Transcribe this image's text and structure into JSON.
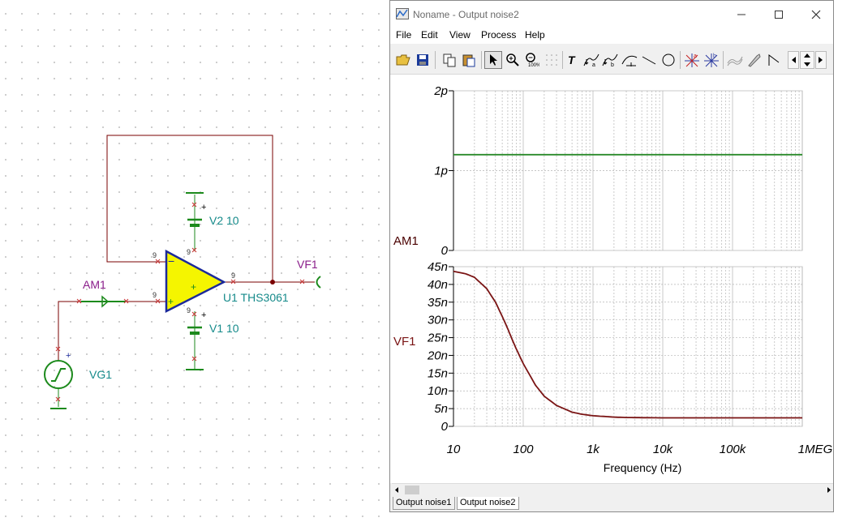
{
  "schematic": {
    "labels": {
      "v2": "V2 10",
      "v1": "V1 10",
      "u1": "U1 THS3061",
      "vf1": "VF1",
      "am1": "AM1",
      "vg1": "VG1"
    },
    "pin_numbers": [
      "9",
      "9",
      "9",
      "9",
      "9"
    ],
    "colors": {
      "opamp_fill": "#f5f500",
      "component": "#1c8a1c",
      "wire": "#7a0000",
      "label": "#158a8a",
      "meter_label": "#8a1d8a"
    }
  },
  "window": {
    "title": "Noname - Output noise2",
    "controls": [
      "minimize",
      "maximize",
      "close"
    ],
    "menu": [
      "File",
      "Edit",
      "View",
      "Process",
      "Help"
    ],
    "toolbar_icons": [
      "open-icon",
      "save-icon",
      "copy-icon",
      "paste-icon",
      "pointer-icon",
      "zoom-in-icon",
      "zoom-100-icon",
      "grid-icon",
      "text-icon",
      "cursor-a-icon",
      "cursor-b-icon",
      "curve-icon",
      "line-icon",
      "circle-icon",
      "marker-a-icon",
      "marker-b-icon",
      "wave-icon",
      "probe-icon",
      "flag-icon",
      "scroll-left-icon",
      "scroll-up-down-icon",
      "scroll-right-icon"
    ],
    "tabs": [
      {
        "label": "Output noise1",
        "active": false
      },
      {
        "label": "Output noise2",
        "active": true
      }
    ]
  },
  "chart_data": [
    {
      "type": "line",
      "ylabel": "AM1",
      "y_ticks": [
        "2p",
        "1p",
        "0"
      ],
      "ylim": [
        0,
        2e-12
      ],
      "xscale": "log",
      "xlim": [
        10,
        1000000
      ],
      "grid": true,
      "series": [
        {
          "color": "#2a8a2a",
          "x": [
            10,
            1000000
          ],
          "y": [
            1.2e-12,
            1.2e-12
          ]
        }
      ]
    },
    {
      "type": "line",
      "ylabel": "VF1",
      "xlabel": "Frequency (Hz)",
      "x_ticks": [
        "10",
        "100",
        "1k",
        "10k",
        "100k",
        "1MEG"
      ],
      "y_ticks": [
        "45n",
        "40n",
        "35n",
        "30n",
        "25n",
        "20n",
        "15n",
        "10n",
        "5n",
        "0"
      ],
      "ylim": [
        0,
        4.5e-08
      ],
      "xscale": "log",
      "xlim": [
        10,
        1000000
      ],
      "grid": true,
      "series": [
        {
          "color": "#7a1414",
          "x": [
            10,
            15,
            20,
            30,
            40,
            50,
            60,
            70,
            80,
            100,
            150,
            200,
            300,
            500,
            700,
            1000,
            2000,
            3000,
            5000,
            10000,
            100000,
            1000000
          ],
          "y": [
            4.37e-08,
            4.3e-08,
            4.2e-08,
            3.88e-08,
            3.5e-08,
            3.1e-08,
            2.75e-08,
            2.43e-08,
            2.17e-08,
            1.77e-08,
            1.16e-08,
            8.5e-09,
            5.9e-09,
            4e-09,
            3.4e-09,
            3e-09,
            2.6e-09,
            2.5e-09,
            2.45e-09,
            2.4e-09,
            2.4e-09,
            2.4e-09
          ]
        }
      ]
    }
  ]
}
